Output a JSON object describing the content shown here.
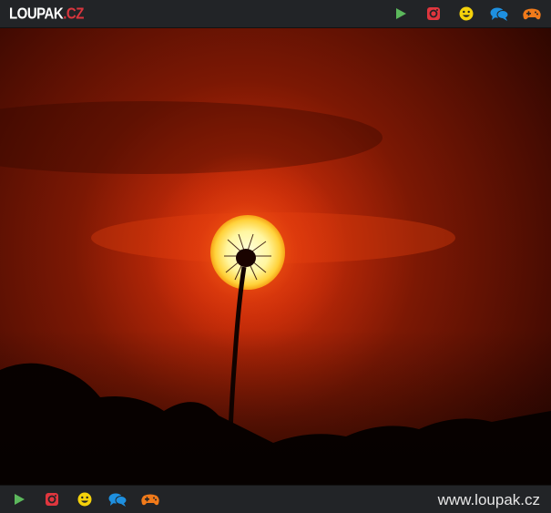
{
  "header": {
    "logo_main": "LOUPAK",
    "logo_tld": ".CZ"
  },
  "nav_icons": [
    {
      "name": "play-icon",
      "color": "#5cb85c"
    },
    {
      "name": "instagram-icon",
      "color": "#e0363e"
    },
    {
      "name": "smiley-icon",
      "color": "#f5d20b"
    },
    {
      "name": "chat-icon",
      "color": "#1e90e0"
    },
    {
      "name": "gamepad-icon",
      "color": "#f07a1a"
    }
  ],
  "footer": {
    "site_url": "www.loupak.cz"
  },
  "photo": {
    "subject": "dandelion-silhouette-sunset",
    "palette": {
      "sky_dark": "#2a0500",
      "sky_mid": "#8a1a05",
      "glow": "#e83a0c",
      "sun": "#fff1a0",
      "ground": "#050100"
    }
  }
}
